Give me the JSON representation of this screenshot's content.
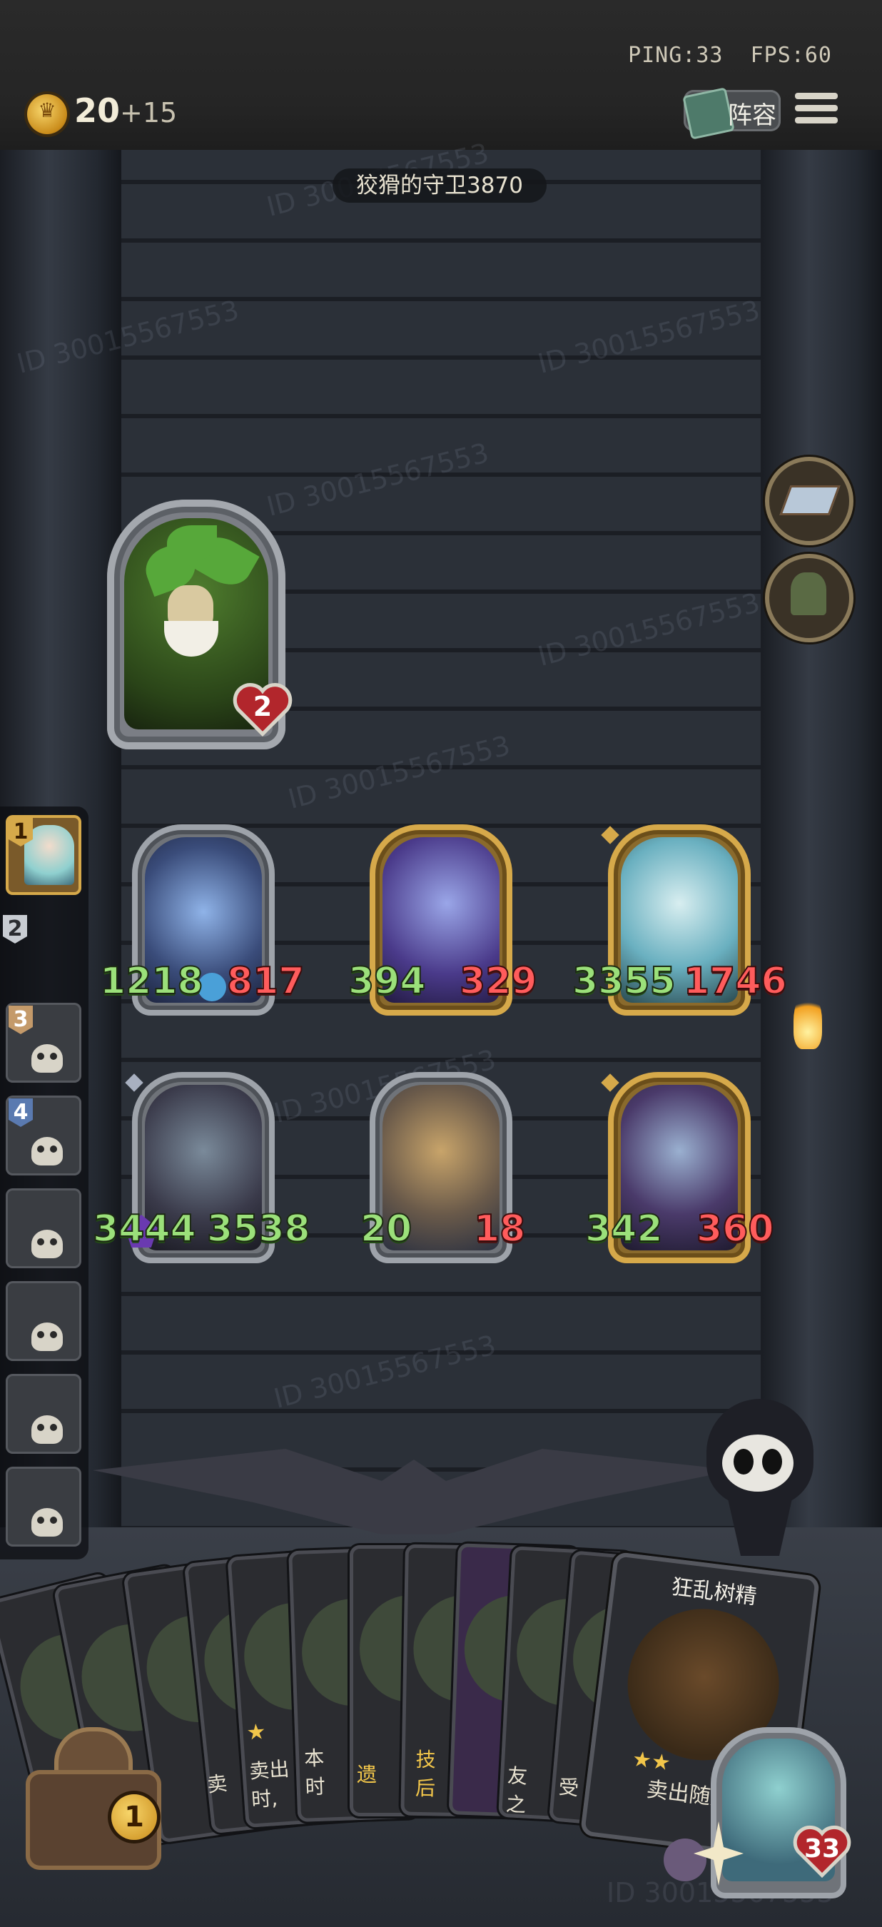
{
  "status": {
    "ping": "PING:33",
    "fps": "FPS:60"
  },
  "resources": {
    "gold": "20",
    "gold_income": "+15",
    "coin_icon": "crown-coin-icon"
  },
  "top_buttons": {
    "lineup_label": "阵容",
    "menu_icon": "hamburger-menu-icon"
  },
  "opponent": {
    "name": "狡猾的守卫3870"
  },
  "watermark": "ID 30015567553",
  "hero": {
    "health": "2"
  },
  "board": {
    "row1": [
      {
        "attack": "1218",
        "health": "817",
        "frame": "silver"
      },
      {
        "attack": "394",
        "health": "329",
        "frame": "gold"
      },
      {
        "attack": "3355",
        "health": "1746",
        "frame": "gold"
      }
    ],
    "row2": [
      {
        "attack": "3444",
        "health": "3538",
        "frame": "silver"
      },
      {
        "attack": "20",
        "health": "18",
        "frame": "silver"
      },
      {
        "attack": "342",
        "health": "360",
        "frame": "gold"
      }
    ]
  },
  "players": [
    {
      "rank": "1"
    },
    {
      "rank": "2"
    },
    {
      "rank": "3"
    },
    {
      "rank": "4"
    },
    {
      "rank": ""
    },
    {
      "rank": ""
    },
    {
      "rank": ""
    },
    {
      "rank": ""
    }
  ],
  "hand": {
    "cards": [
      {
        "text": ""
      },
      {
        "text": ""
      },
      {
        "text": ""
      },
      {
        "text": "卖"
      },
      {
        "text": "卖出\n时,"
      },
      {
        "text": "本\n时"
      },
      {
        "text": "遗"
      },
      {
        "text": "技\n后"
      },
      {
        "text": ""
      },
      {
        "text": "友\n之"
      },
      {
        "text": "受"
      }
    ],
    "featured": {
      "name": "狂乱树精",
      "text": "卖出随从"
    }
  },
  "shop": {
    "tier": "1"
  },
  "player": {
    "health": "33"
  },
  "colors": {
    "gold_frame": "#d6a94a",
    "silver_frame": "#9ea3aa",
    "attack": "#9be07a",
    "health": "#ff5c5c"
  }
}
